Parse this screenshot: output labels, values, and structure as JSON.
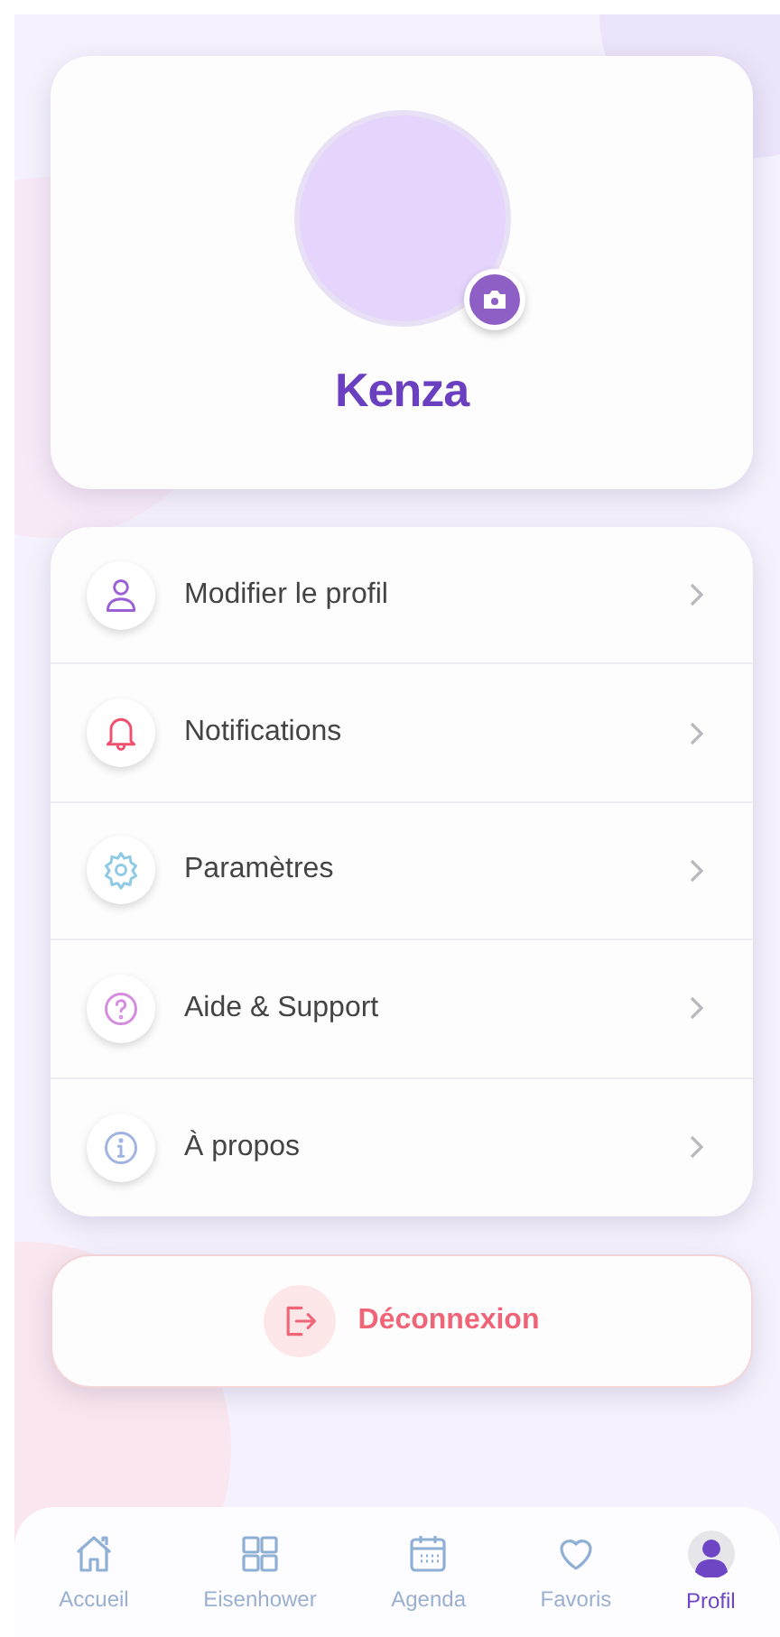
{
  "profile": {
    "name": "Kenza"
  },
  "menu": [
    {
      "kind": "user",
      "label": "Modifier le profil",
      "color": "#9b5fd6"
    },
    {
      "kind": "bell",
      "label": "Notifications",
      "color": "#f0506e"
    },
    {
      "kind": "gear",
      "label": "Paramètres",
      "color": "#8ecae6"
    },
    {
      "kind": "help",
      "label": "Aide & Support",
      "color": "#d58be0"
    },
    {
      "kind": "info",
      "label": "À propos",
      "color": "#9fb4e0"
    }
  ],
  "logout": {
    "label": "Déconnexion"
  },
  "nav": [
    {
      "kind": "home",
      "label": "Accueil",
      "selected": false
    },
    {
      "kind": "grid",
      "label": "Eisenhower",
      "selected": false
    },
    {
      "kind": "calendar",
      "label": "Agenda",
      "selected": false
    },
    {
      "kind": "heart",
      "label": "Favoris",
      "selected": false
    },
    {
      "kind": "avatar",
      "label": "Profil",
      "selected": true
    }
  ]
}
